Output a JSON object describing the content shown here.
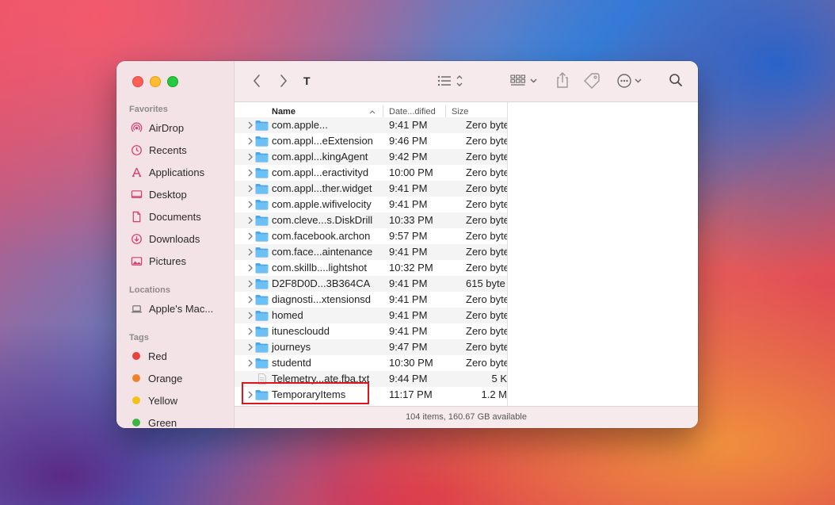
{
  "window": {
    "folder_title": "T"
  },
  "sidebar": {
    "favorites_header": "Favorites",
    "favorites": [
      {
        "label": "AirDrop",
        "icon": "airdrop-icon"
      },
      {
        "label": "Recents",
        "icon": "clock-icon"
      },
      {
        "label": "Applications",
        "icon": "applications-icon"
      },
      {
        "label": "Desktop",
        "icon": "desktop-icon"
      },
      {
        "label": "Documents",
        "icon": "document-icon"
      },
      {
        "label": "Downloads",
        "icon": "download-icon"
      },
      {
        "label": "Pictures",
        "icon": "pictures-icon"
      }
    ],
    "locations_header": "Locations",
    "locations": [
      {
        "label": "Apple's Mac...",
        "icon": "laptop-icon"
      }
    ],
    "tags_header": "Tags",
    "tags": [
      {
        "label": "Red",
        "color": "#e8403a"
      },
      {
        "label": "Orange",
        "color": "#f0832a"
      },
      {
        "label": "Yellow",
        "color": "#f2c21b"
      },
      {
        "label": "Green",
        "color": "#3cb544"
      }
    ]
  },
  "columns": {
    "name": "Name",
    "date": "Date...dified",
    "size": "Size"
  },
  "files": [
    {
      "name": "com.apple...",
      "date": "9:41 PM",
      "size": "Zero byte",
      "type": "folder"
    },
    {
      "name": "com.appl...eExtension",
      "date": "9:46 PM",
      "size": "Zero byte",
      "type": "folder"
    },
    {
      "name": "com.appl...kingAgent",
      "date": "9:42 PM",
      "size": "Zero byte",
      "type": "folder"
    },
    {
      "name": "com.appl...eractivityd",
      "date": "10:00 PM",
      "size": "Zero byte",
      "type": "folder"
    },
    {
      "name": "com.appl...ther.widget",
      "date": "9:41 PM",
      "size": "Zero byte",
      "type": "folder"
    },
    {
      "name": "com.apple.wifivelocity",
      "date": "9:41 PM",
      "size": "Zero byte",
      "type": "folder"
    },
    {
      "name": "com.cleve...s.DiskDrill",
      "date": "10:33 PM",
      "size": "Zero byte",
      "type": "folder"
    },
    {
      "name": "com.facebook.archon",
      "date": "9:57 PM",
      "size": "Zero byte",
      "type": "folder"
    },
    {
      "name": "com.face...aintenance",
      "date": "9:41 PM",
      "size": "Zero byte",
      "type": "folder"
    },
    {
      "name": "com.skillb....lightshot",
      "date": "10:32 PM",
      "size": "Zero byte",
      "type": "folder"
    },
    {
      "name": "D2F8D0D...3B364CA",
      "date": "9:41 PM",
      "size": "615 byte",
      "type": "folder"
    },
    {
      "name": "diagnosti...xtensionsd",
      "date": "9:41 PM",
      "size": "Zero byte",
      "type": "folder"
    },
    {
      "name": "homed",
      "date": "9:41 PM",
      "size": "Zero byte",
      "type": "folder"
    },
    {
      "name": "itunescloudd",
      "date": "9:41 PM",
      "size": "Zero byte",
      "type": "folder"
    },
    {
      "name": "journeys",
      "date": "9:47 PM",
      "size": "Zero byte",
      "type": "folder"
    },
    {
      "name": "studentd",
      "date": "10:30 PM",
      "size": "Zero byte",
      "type": "folder"
    },
    {
      "name": "Telemetry...ate.fba.txt",
      "date": "9:44 PM",
      "size": "5 K",
      "type": "file"
    },
    {
      "name": "TemporaryItems",
      "date": "11:17 PM",
      "size": "1.2 M",
      "type": "folder"
    }
  ],
  "status": {
    "text": "104 items, 160.67 GB available"
  },
  "colors": {
    "folder": "#5ab4ee",
    "sidebar_icon": "#d63b6a",
    "highlight": "#e0141e"
  }
}
